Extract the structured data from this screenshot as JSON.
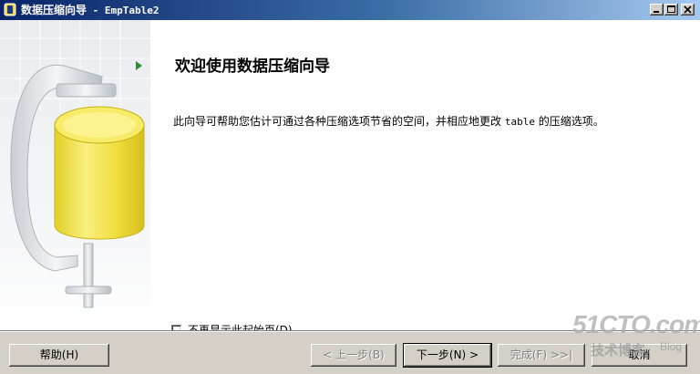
{
  "window": {
    "title": "数据压缩向导",
    "title_separator": " - ",
    "title_object": "EmpTable2"
  },
  "controls": {
    "minimize_icon": "minimize-icon",
    "maximize_icon": "maximize-icon",
    "close_icon": "close-icon"
  },
  "page": {
    "heading": "欢迎使用数据压缩向导",
    "desc_before": "此向导可帮助您估计可通过各种压缩选项节省的空间，并相应地更改 ",
    "desc_code": "table",
    "desc_after": " 的压缩选项。",
    "checkbox_label": "不再显示此起始页(D)。",
    "checkbox_checked": false
  },
  "buttons": {
    "help": "帮助(H)",
    "back": "< 上一步(B)",
    "next": "下一步(N) >",
    "finish": "完成(F) >>|",
    "cancel": "取消"
  },
  "watermark": {
    "site": "51CTO.com",
    "tagline": "技术博客",
    "blog": "Blog"
  },
  "colors": {
    "titlebar_start": "#0a246a",
    "titlebar_end": "#a6caf0",
    "arrow": "#2e8b2e",
    "cylinder": "#f2e23a"
  }
}
